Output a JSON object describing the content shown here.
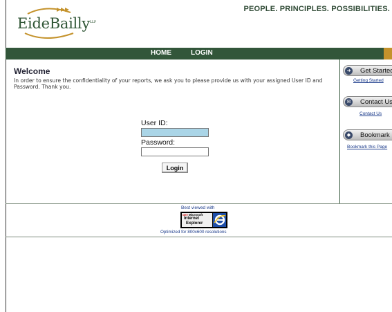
{
  "header": {
    "logo_text": "EideBailly",
    "logo_mark": "LLP",
    "tagline": "PEOPLE. PRINCIPLES. POSSIBILITIES."
  },
  "nav": {
    "home": "HOME",
    "login": "LOGIN",
    "bar_color": "#32563a",
    "accent_color": "#c4922b"
  },
  "main": {
    "title": "Welcome",
    "intro": "In order to ensure the confidentiality of your reports, we ask you to please provide us with your assigned User ID and Password. Thank you."
  },
  "form": {
    "user_label": "User ID:",
    "user_value": "",
    "password_label": "Password:",
    "password_value": "",
    "submit_label": "Login",
    "user_field_color": "#aad5e7"
  },
  "sidebar": {
    "items": [
      {
        "label": "Get Started",
        "link": "Getting Started",
        "icon": "arrow-icon"
      },
      {
        "label": "Contact Us",
        "link": "Contact Us",
        "icon": "envelope-icon"
      },
      {
        "label": "Bookmark",
        "link": "Bookmark this Page",
        "icon": "bookmark-icon"
      }
    ]
  },
  "footer": {
    "best_viewed": "Best viewed with",
    "badge_get": "GET",
    "badge_microsoft": "Microsoft",
    "badge_internet": "Internet",
    "badge_explorer": "Explorer",
    "optimized": "Optimized for 800x600 resolutions"
  }
}
